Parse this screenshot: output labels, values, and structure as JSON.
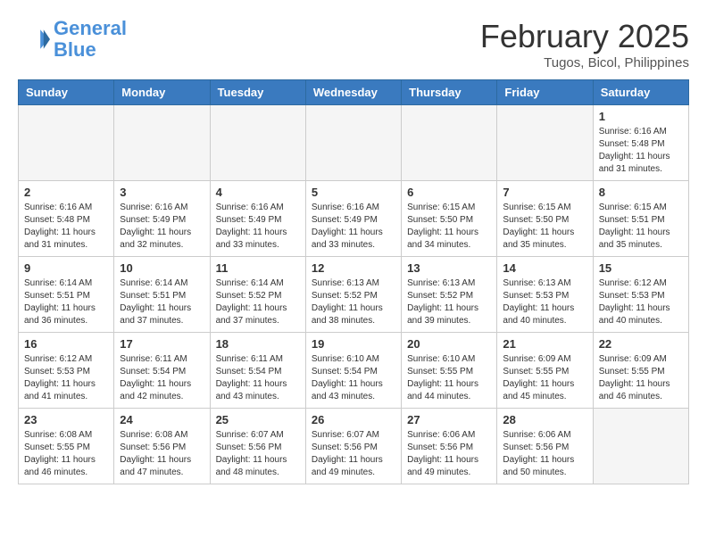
{
  "logo": {
    "line1": "General",
    "line2": "Blue"
  },
  "title": "February 2025",
  "subtitle": "Tugos, Bicol, Philippines",
  "days": [
    "Sunday",
    "Monday",
    "Tuesday",
    "Wednesday",
    "Thursday",
    "Friday",
    "Saturday"
  ],
  "weeks": [
    [
      {
        "day": "",
        "info": ""
      },
      {
        "day": "",
        "info": ""
      },
      {
        "day": "",
        "info": ""
      },
      {
        "day": "",
        "info": ""
      },
      {
        "day": "",
        "info": ""
      },
      {
        "day": "",
        "info": ""
      },
      {
        "day": "1",
        "info": "Sunrise: 6:16 AM\nSunset: 5:48 PM\nDaylight: 11 hours and 31 minutes."
      }
    ],
    [
      {
        "day": "2",
        "info": "Sunrise: 6:16 AM\nSunset: 5:48 PM\nDaylight: 11 hours and 31 minutes."
      },
      {
        "day": "3",
        "info": "Sunrise: 6:16 AM\nSunset: 5:49 PM\nDaylight: 11 hours and 32 minutes."
      },
      {
        "day": "4",
        "info": "Sunrise: 6:16 AM\nSunset: 5:49 PM\nDaylight: 11 hours and 33 minutes."
      },
      {
        "day": "5",
        "info": "Sunrise: 6:16 AM\nSunset: 5:49 PM\nDaylight: 11 hours and 33 minutes."
      },
      {
        "day": "6",
        "info": "Sunrise: 6:15 AM\nSunset: 5:50 PM\nDaylight: 11 hours and 34 minutes."
      },
      {
        "day": "7",
        "info": "Sunrise: 6:15 AM\nSunset: 5:50 PM\nDaylight: 11 hours and 35 minutes."
      },
      {
        "day": "8",
        "info": "Sunrise: 6:15 AM\nSunset: 5:51 PM\nDaylight: 11 hours and 35 minutes."
      }
    ],
    [
      {
        "day": "9",
        "info": "Sunrise: 6:14 AM\nSunset: 5:51 PM\nDaylight: 11 hours and 36 minutes."
      },
      {
        "day": "10",
        "info": "Sunrise: 6:14 AM\nSunset: 5:51 PM\nDaylight: 11 hours and 37 minutes."
      },
      {
        "day": "11",
        "info": "Sunrise: 6:14 AM\nSunset: 5:52 PM\nDaylight: 11 hours and 37 minutes."
      },
      {
        "day": "12",
        "info": "Sunrise: 6:13 AM\nSunset: 5:52 PM\nDaylight: 11 hours and 38 minutes."
      },
      {
        "day": "13",
        "info": "Sunrise: 6:13 AM\nSunset: 5:52 PM\nDaylight: 11 hours and 39 minutes."
      },
      {
        "day": "14",
        "info": "Sunrise: 6:13 AM\nSunset: 5:53 PM\nDaylight: 11 hours and 40 minutes."
      },
      {
        "day": "15",
        "info": "Sunrise: 6:12 AM\nSunset: 5:53 PM\nDaylight: 11 hours and 40 minutes."
      }
    ],
    [
      {
        "day": "16",
        "info": "Sunrise: 6:12 AM\nSunset: 5:53 PM\nDaylight: 11 hours and 41 minutes."
      },
      {
        "day": "17",
        "info": "Sunrise: 6:11 AM\nSunset: 5:54 PM\nDaylight: 11 hours and 42 minutes."
      },
      {
        "day": "18",
        "info": "Sunrise: 6:11 AM\nSunset: 5:54 PM\nDaylight: 11 hours and 43 minutes."
      },
      {
        "day": "19",
        "info": "Sunrise: 6:10 AM\nSunset: 5:54 PM\nDaylight: 11 hours and 43 minutes."
      },
      {
        "day": "20",
        "info": "Sunrise: 6:10 AM\nSunset: 5:55 PM\nDaylight: 11 hours and 44 minutes."
      },
      {
        "day": "21",
        "info": "Sunrise: 6:09 AM\nSunset: 5:55 PM\nDaylight: 11 hours and 45 minutes."
      },
      {
        "day": "22",
        "info": "Sunrise: 6:09 AM\nSunset: 5:55 PM\nDaylight: 11 hours and 46 minutes."
      }
    ],
    [
      {
        "day": "23",
        "info": "Sunrise: 6:08 AM\nSunset: 5:55 PM\nDaylight: 11 hours and 46 minutes."
      },
      {
        "day": "24",
        "info": "Sunrise: 6:08 AM\nSunset: 5:56 PM\nDaylight: 11 hours and 47 minutes."
      },
      {
        "day": "25",
        "info": "Sunrise: 6:07 AM\nSunset: 5:56 PM\nDaylight: 11 hours and 48 minutes."
      },
      {
        "day": "26",
        "info": "Sunrise: 6:07 AM\nSunset: 5:56 PM\nDaylight: 11 hours and 49 minutes."
      },
      {
        "day": "27",
        "info": "Sunrise: 6:06 AM\nSunset: 5:56 PM\nDaylight: 11 hours and 49 minutes."
      },
      {
        "day": "28",
        "info": "Sunrise: 6:06 AM\nSunset: 5:56 PM\nDaylight: 11 hours and 50 minutes."
      },
      {
        "day": "",
        "info": ""
      }
    ]
  ]
}
